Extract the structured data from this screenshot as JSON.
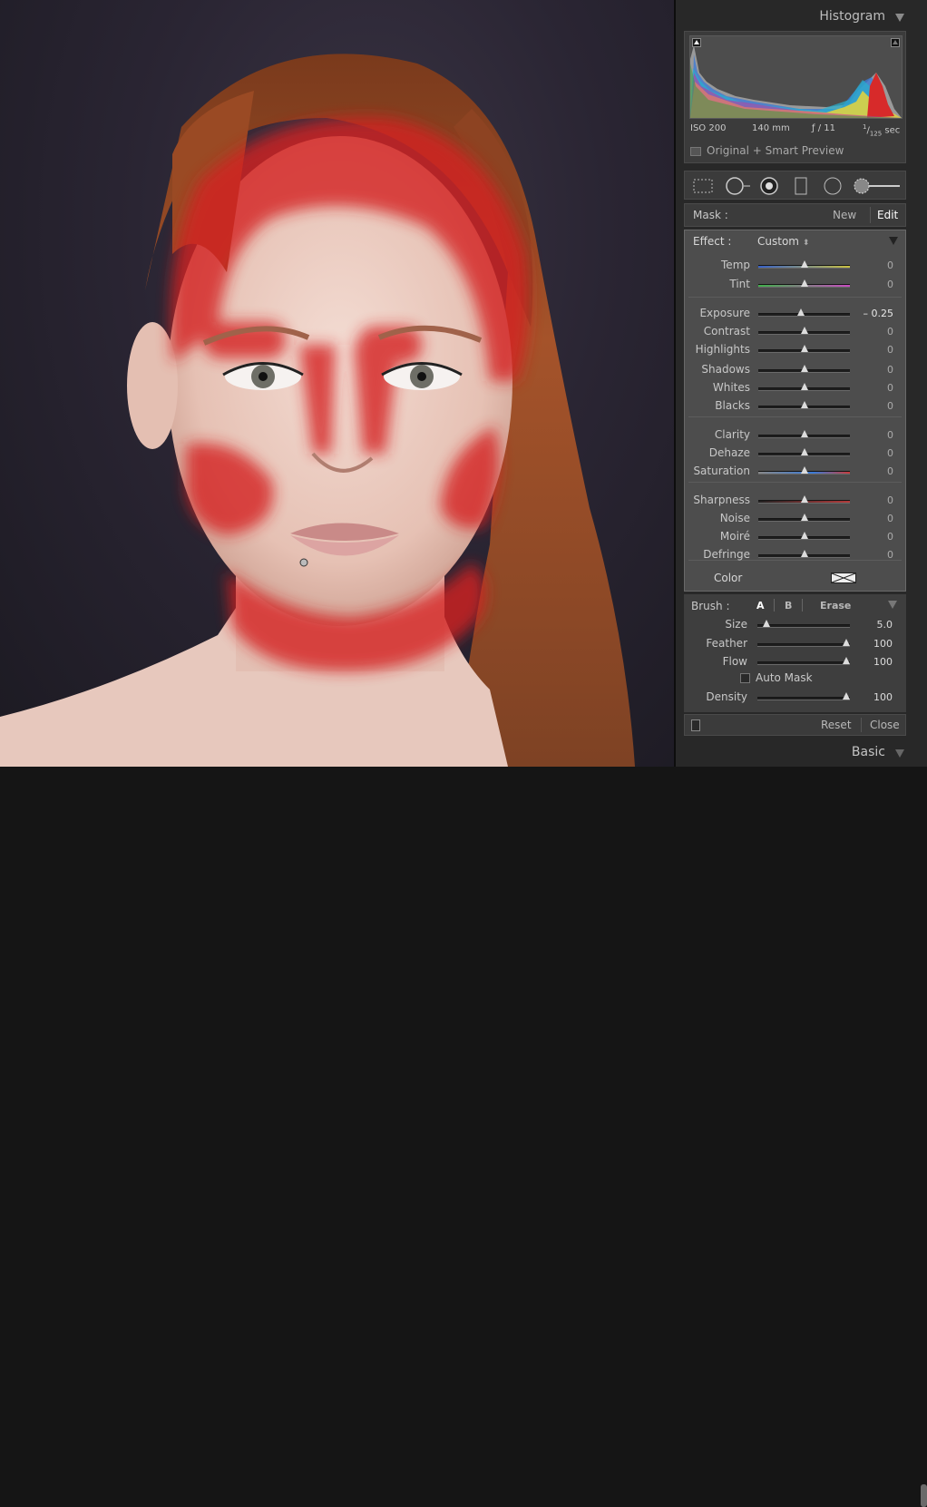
{
  "histogram": {
    "title": "Histogram",
    "iso": "ISO 200",
    "focal": "140 mm",
    "aperture": "ƒ / 11",
    "shutter_num": "1",
    "shutter_den": "125",
    "shutter_unit": " sec",
    "preview_label": "Original + Smart Preview"
  },
  "mask": {
    "label": "Mask :",
    "new": "New",
    "edit": "Edit"
  },
  "effect": {
    "label": "Effect :",
    "preset": "Custom",
    "preset_arrows": "⬍"
  },
  "sliders": [
    {
      "label": "Temp",
      "value": "0",
      "pos": 0.5,
      "track": "temp"
    },
    {
      "label": "Tint",
      "value": "0",
      "pos": 0.5,
      "track": "tint"
    },
    {
      "label": "Exposure",
      "value": "– 0.25",
      "pos": 0.47,
      "track": "plain"
    },
    {
      "label": "Contrast",
      "value": "0",
      "pos": 0.5,
      "track": "plain"
    },
    {
      "label": "Highlights",
      "value": "0",
      "pos": 0.5,
      "track": "plain"
    },
    {
      "label": "Shadows",
      "value": "0",
      "pos": 0.5,
      "track": "plain"
    },
    {
      "label": "Whites",
      "value": "0",
      "pos": 0.5,
      "track": "plain"
    },
    {
      "label": "Blacks",
      "value": "0",
      "pos": 0.5,
      "track": "plain"
    },
    {
      "label": "Clarity",
      "value": "0",
      "pos": 0.5,
      "track": "plain"
    },
    {
      "label": "Dehaze",
      "value": "0",
      "pos": 0.5,
      "track": "plain"
    },
    {
      "label": "Saturation",
      "value": "0",
      "pos": 0.5,
      "track": "saturation"
    },
    {
      "label": "Sharpness",
      "value": "0",
      "pos": 0.5,
      "track": "sharpness"
    },
    {
      "label": "Noise",
      "value": "0",
      "pos": 0.5,
      "track": "plain"
    },
    {
      "label": "Moiré",
      "value": "0",
      "pos": 0.5,
      "track": "plain"
    },
    {
      "label": "Defringe",
      "value": "0",
      "pos": 0.5,
      "track": "plain"
    }
  ],
  "color": {
    "label": "Color"
  },
  "brush": {
    "label": "Brush :",
    "tab_a": "A",
    "tab_b": "B",
    "tab_erase": "Erase",
    "sliders": [
      {
        "label": "Size",
        "value": "5.0",
        "pos": 0.1
      },
      {
        "label": "Feather",
        "value": "100",
        "pos": 1.0
      },
      {
        "label": "Flow",
        "value": "100",
        "pos": 1.0
      }
    ],
    "auto_mask": "Auto Mask",
    "density": {
      "label": "Density",
      "value": "100",
      "pos": 1.0
    }
  },
  "footer": {
    "reset": "Reset",
    "close": "Close"
  },
  "basic": {
    "title": "Basic"
  },
  "colors": {
    "mask_overlay": "#d42020",
    "panel_bg": "#4d4d4d",
    "sidebar_bg": "#282828"
  }
}
